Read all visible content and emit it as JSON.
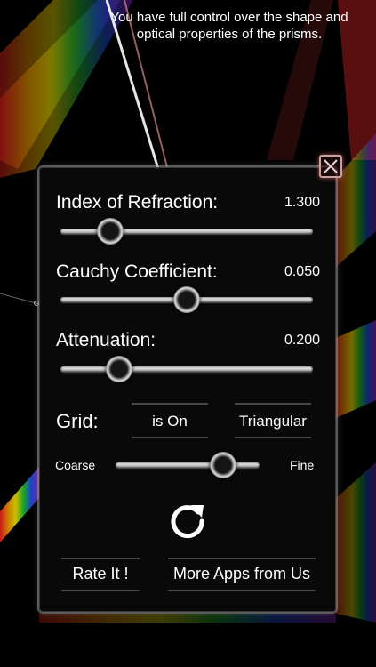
{
  "caption": "You have full control over the shape and optical properties of the prisms.",
  "sliders": [
    {
      "label": "Index of Refraction:",
      "value_text": "1.300",
      "level": 0.16
    },
    {
      "label": "Cauchy Coefficient:",
      "value_text": "0.050",
      "level": 0.5
    },
    {
      "label": "Attenuation:",
      "value_text": "0.200",
      "level": 0.2
    }
  ],
  "grid": {
    "label": "Grid:",
    "state": "is On",
    "type": "Triangular",
    "coarse_label": "Coarse",
    "fine_label": "Fine",
    "fineness_level": 0.8
  },
  "buttons": {
    "rate": "Rate It !",
    "more_apps": "More Apps from Us"
  },
  "colors": {
    "panel_border": "#9a9a9a",
    "close_border": "#c9a0a0"
  }
}
